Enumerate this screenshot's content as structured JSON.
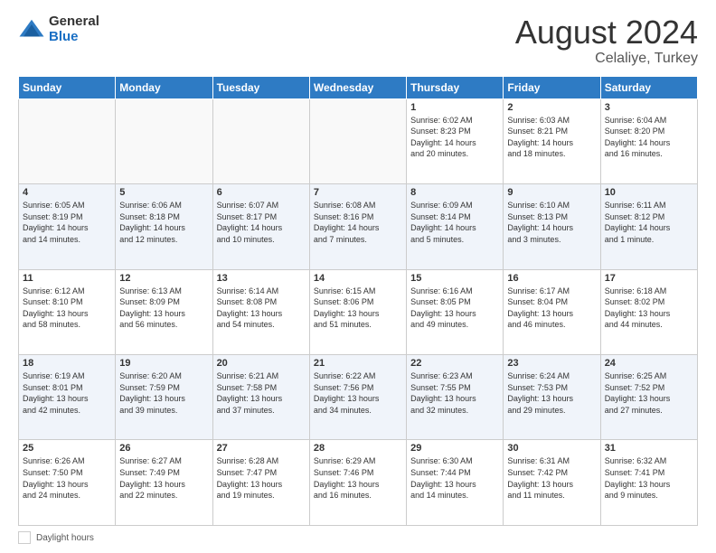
{
  "logo": {
    "general": "General",
    "blue": "Blue"
  },
  "title": "August 2024",
  "location": "Celaliye, Turkey",
  "days_of_week": [
    "Sunday",
    "Monday",
    "Tuesday",
    "Wednesday",
    "Thursday",
    "Friday",
    "Saturday"
  ],
  "footer_label": "Daylight hours",
  "weeks": [
    [
      {
        "day": "",
        "info": ""
      },
      {
        "day": "",
        "info": ""
      },
      {
        "day": "",
        "info": ""
      },
      {
        "day": "",
        "info": ""
      },
      {
        "day": "1",
        "info": "Sunrise: 6:02 AM\nSunset: 8:23 PM\nDaylight: 14 hours\nand 20 minutes."
      },
      {
        "day": "2",
        "info": "Sunrise: 6:03 AM\nSunset: 8:21 PM\nDaylight: 14 hours\nand 18 minutes."
      },
      {
        "day": "3",
        "info": "Sunrise: 6:04 AM\nSunset: 8:20 PM\nDaylight: 14 hours\nand 16 minutes."
      }
    ],
    [
      {
        "day": "4",
        "info": "Sunrise: 6:05 AM\nSunset: 8:19 PM\nDaylight: 14 hours\nand 14 minutes."
      },
      {
        "day": "5",
        "info": "Sunrise: 6:06 AM\nSunset: 8:18 PM\nDaylight: 14 hours\nand 12 minutes."
      },
      {
        "day": "6",
        "info": "Sunrise: 6:07 AM\nSunset: 8:17 PM\nDaylight: 14 hours\nand 10 minutes."
      },
      {
        "day": "7",
        "info": "Sunrise: 6:08 AM\nSunset: 8:16 PM\nDaylight: 14 hours\nand 7 minutes."
      },
      {
        "day": "8",
        "info": "Sunrise: 6:09 AM\nSunset: 8:14 PM\nDaylight: 14 hours\nand 5 minutes."
      },
      {
        "day": "9",
        "info": "Sunrise: 6:10 AM\nSunset: 8:13 PM\nDaylight: 14 hours\nand 3 minutes."
      },
      {
        "day": "10",
        "info": "Sunrise: 6:11 AM\nSunset: 8:12 PM\nDaylight: 14 hours\nand 1 minute."
      }
    ],
    [
      {
        "day": "11",
        "info": "Sunrise: 6:12 AM\nSunset: 8:10 PM\nDaylight: 13 hours\nand 58 minutes."
      },
      {
        "day": "12",
        "info": "Sunrise: 6:13 AM\nSunset: 8:09 PM\nDaylight: 13 hours\nand 56 minutes."
      },
      {
        "day": "13",
        "info": "Sunrise: 6:14 AM\nSunset: 8:08 PM\nDaylight: 13 hours\nand 54 minutes."
      },
      {
        "day": "14",
        "info": "Sunrise: 6:15 AM\nSunset: 8:06 PM\nDaylight: 13 hours\nand 51 minutes."
      },
      {
        "day": "15",
        "info": "Sunrise: 6:16 AM\nSunset: 8:05 PM\nDaylight: 13 hours\nand 49 minutes."
      },
      {
        "day": "16",
        "info": "Sunrise: 6:17 AM\nSunset: 8:04 PM\nDaylight: 13 hours\nand 46 minutes."
      },
      {
        "day": "17",
        "info": "Sunrise: 6:18 AM\nSunset: 8:02 PM\nDaylight: 13 hours\nand 44 minutes."
      }
    ],
    [
      {
        "day": "18",
        "info": "Sunrise: 6:19 AM\nSunset: 8:01 PM\nDaylight: 13 hours\nand 42 minutes."
      },
      {
        "day": "19",
        "info": "Sunrise: 6:20 AM\nSunset: 7:59 PM\nDaylight: 13 hours\nand 39 minutes."
      },
      {
        "day": "20",
        "info": "Sunrise: 6:21 AM\nSunset: 7:58 PM\nDaylight: 13 hours\nand 37 minutes."
      },
      {
        "day": "21",
        "info": "Sunrise: 6:22 AM\nSunset: 7:56 PM\nDaylight: 13 hours\nand 34 minutes."
      },
      {
        "day": "22",
        "info": "Sunrise: 6:23 AM\nSunset: 7:55 PM\nDaylight: 13 hours\nand 32 minutes."
      },
      {
        "day": "23",
        "info": "Sunrise: 6:24 AM\nSunset: 7:53 PM\nDaylight: 13 hours\nand 29 minutes."
      },
      {
        "day": "24",
        "info": "Sunrise: 6:25 AM\nSunset: 7:52 PM\nDaylight: 13 hours\nand 27 minutes."
      }
    ],
    [
      {
        "day": "25",
        "info": "Sunrise: 6:26 AM\nSunset: 7:50 PM\nDaylight: 13 hours\nand 24 minutes."
      },
      {
        "day": "26",
        "info": "Sunrise: 6:27 AM\nSunset: 7:49 PM\nDaylight: 13 hours\nand 22 minutes."
      },
      {
        "day": "27",
        "info": "Sunrise: 6:28 AM\nSunset: 7:47 PM\nDaylight: 13 hours\nand 19 minutes."
      },
      {
        "day": "28",
        "info": "Sunrise: 6:29 AM\nSunset: 7:46 PM\nDaylight: 13 hours\nand 16 minutes."
      },
      {
        "day": "29",
        "info": "Sunrise: 6:30 AM\nSunset: 7:44 PM\nDaylight: 13 hours\nand 14 minutes."
      },
      {
        "day": "30",
        "info": "Sunrise: 6:31 AM\nSunset: 7:42 PM\nDaylight: 13 hours\nand 11 minutes."
      },
      {
        "day": "31",
        "info": "Sunrise: 6:32 AM\nSunset: 7:41 PM\nDaylight: 13 hours\nand 9 minutes."
      }
    ]
  ]
}
